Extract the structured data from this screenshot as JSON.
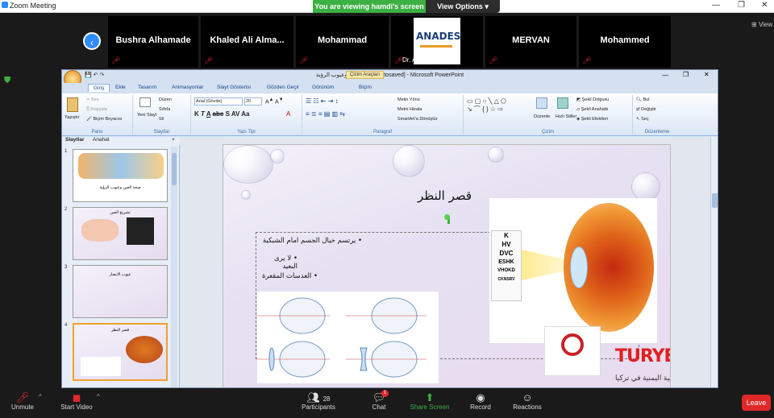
{
  "zoom": {
    "window_title": "Zoom Meeting",
    "banner": "You are viewing hamdi's screen",
    "view_options": "View Options",
    "view_label": "View",
    "participants": [
      {
        "name": "Bushra Alhamade"
      },
      {
        "name": "Khaled Ali Alma..."
      },
      {
        "name": "Mohammad"
      },
      {
        "name": "Dr. ABDULKA..."
      },
      {
        "name": "MERVAN"
      },
      {
        "name": "Mohammed"
      }
    ],
    "toolbar": {
      "unmute": "Unmute",
      "start_video": "Start Video",
      "participants": "Participants",
      "participants_count": "28",
      "chat": "Chat",
      "chat_badge": "1",
      "share_screen": "Share Screen",
      "record": "Record",
      "reactions": "Reactions",
      "leave": "Leave"
    }
  },
  "ppt": {
    "title": "صحة العين وعيوب الرؤية [Autosaved] - Microsoft PowerPoint",
    "context_tab": "Çizim Araçları",
    "tabs": [
      "Giriş",
      "Ekle",
      "Tasarım",
      "Animasyonlar",
      "Slayt Gösterisi",
      "Gözden Geçir",
      "Görünüm",
      "Biçim"
    ],
    "ribbon": {
      "clipboard": {
        "label": "Pano",
        "paste": "Yapıştır",
        "cut": "Kes",
        "copy": "Kopyala",
        "format_painter": "Biçim Boyacısı"
      },
      "slides": {
        "label": "Slaytlar",
        "new_slide": "Yeni Slayt",
        "layout": "Düzen",
        "reset": "Sıfırla",
        "delete": "Sil"
      },
      "font": {
        "label": "Yazı Tipi",
        "font_name": "Arial (Gövde)",
        "font_size": "20"
      },
      "paragraph": {
        "label": "Paragraf",
        "text_direction": "Metin Yönü",
        "align_text": "Metni Hizala",
        "smartart": "SmartArt'a Dönüştür"
      },
      "drawing": {
        "label": "Çizim",
        "arrange": "Düzenle",
        "quick_styles": "Hızlı Stiller",
        "fill": "Şekil Dolgusu",
        "outline": "Şekil Anahattı",
        "effects": "Şekil Efektleri"
      },
      "editing": {
        "label": "Düzenleme",
        "find": "Bul",
        "replace": "Değiştir",
        "select": "Seç"
      }
    },
    "panel_tabs": [
      "Slaytlar",
      "Anahat"
    ],
    "thumbs": [
      {
        "num": "1",
        "title": "صحة العين وعيوب الرؤية"
      },
      {
        "num": "2",
        "title": "تشريح العين"
      },
      {
        "num": "3",
        "title": "عيوب الابصار"
      },
      {
        "num": "4",
        "title": "قصر النظر"
      }
    ],
    "slide": {
      "title": "قصر النظر",
      "bullets": [
        "يرتسم خيال الجسم امام الشبكية",
        "لا يرى البعيد",
        "العدسات المقعرة"
      ],
      "chart_letters": [
        "K",
        "HV",
        "DVC",
        "ESHK",
        "VHOKD",
        "CKNSRV"
      ],
      "logo_text": "TURYED",
      "logo_sub": "الجالية اليمنية في تركيا"
    }
  }
}
